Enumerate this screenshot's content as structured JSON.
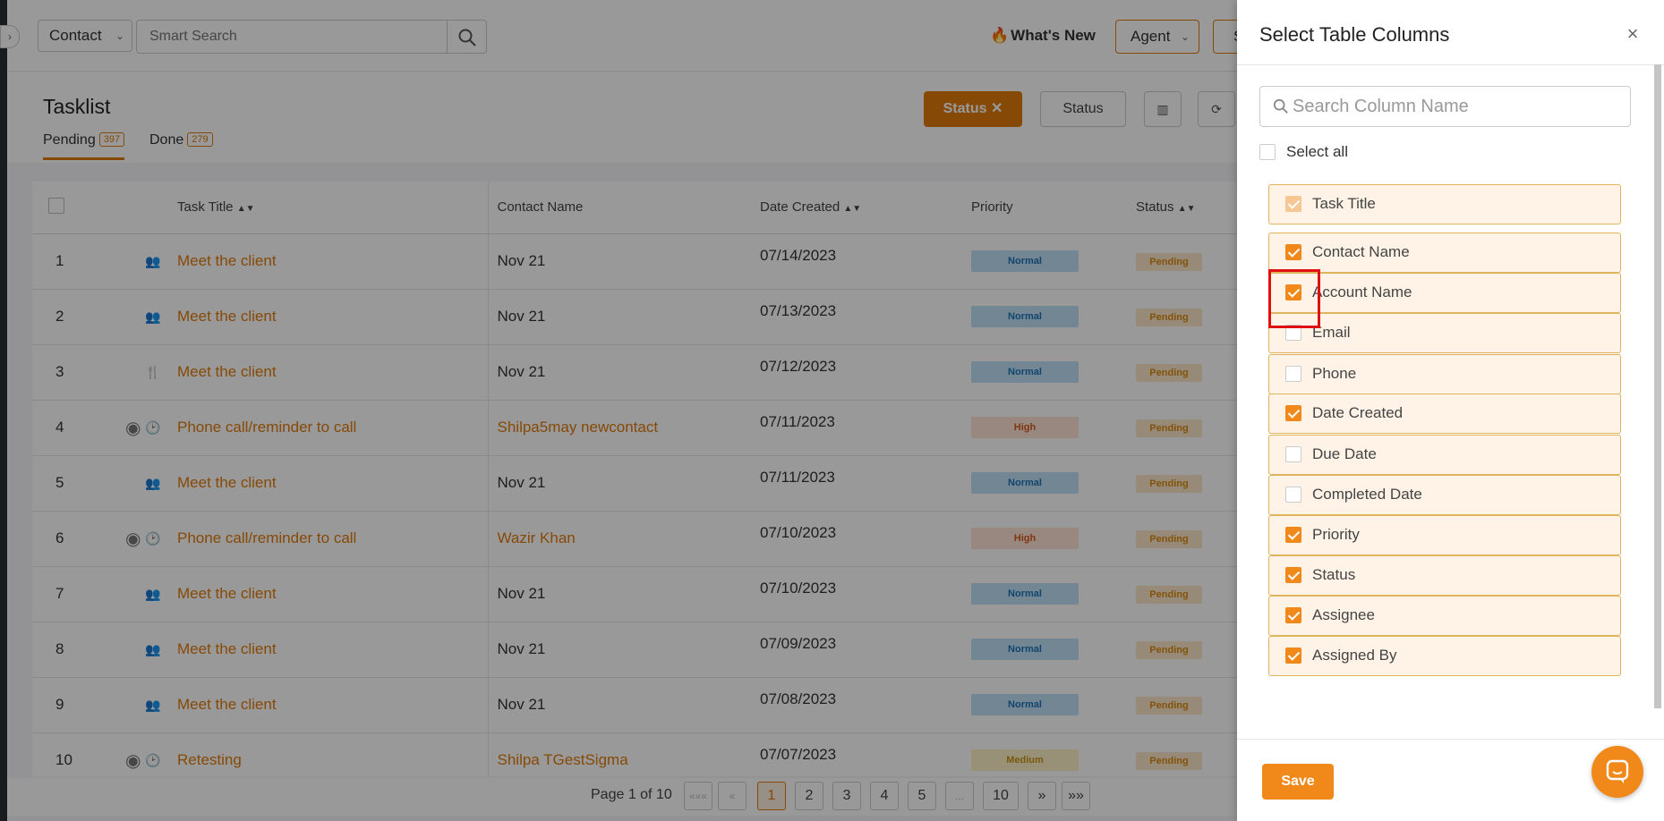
{
  "topbar": {
    "entity_select": "Contact",
    "search_placeholder": "Smart Search",
    "whats_new": "What's New",
    "agent_select": "Agent",
    "cut_button": "S"
  },
  "header": {
    "title": "Tasklist",
    "tabs": [
      {
        "label": "Pending",
        "count": "397"
      },
      {
        "label": "Done",
        "count": "279"
      }
    ],
    "status_filter_chip": "Status ✕",
    "status_button": "Status"
  },
  "table": {
    "columns": [
      "Task Title",
      "Contact Name",
      "Date Created",
      "Priority",
      "Status"
    ],
    "rows": [
      {
        "num": "1",
        "title": "Meet the client",
        "contact": "Nov 21",
        "date": "07/14/2023",
        "priority": "Normal",
        "status": "Pending"
      },
      {
        "num": "2",
        "title": "Meet the client",
        "contact": "Nov 21",
        "date": "07/13/2023",
        "priority": "Normal",
        "status": "Pending"
      },
      {
        "num": "3",
        "title": "Meet the client",
        "contact": "Nov 21",
        "date": "07/12/2023",
        "priority": "Normal",
        "status": "Pending"
      },
      {
        "num": "4",
        "title": "Phone call/reminder to call",
        "contact": "Shilpa5may newcontact",
        "date": "07/11/2023",
        "priority": "High",
        "status": "Pending"
      },
      {
        "num": "5",
        "title": "Meet the client",
        "contact": "Nov 21",
        "date": "07/11/2023",
        "priority": "Normal",
        "status": "Pending"
      },
      {
        "num": "6",
        "title": "Phone call/reminder to call",
        "contact": "Wazir Khan",
        "date": "07/10/2023",
        "priority": "High",
        "status": "Pending"
      },
      {
        "num": "7",
        "title": "Meet the client",
        "contact": "Nov 21",
        "date": "07/10/2023",
        "priority": "Normal",
        "status": "Pending"
      },
      {
        "num": "8",
        "title": "Meet the client",
        "contact": "Nov 21",
        "date": "07/09/2023",
        "priority": "Normal",
        "status": "Pending"
      },
      {
        "num": "9",
        "title": "Meet the client",
        "contact": "Nov 21",
        "date": "07/08/2023",
        "priority": "Normal",
        "status": "Pending"
      },
      {
        "num": "10",
        "title": "Retesting",
        "contact": "Shilpa TGestSigma",
        "date": "07/07/2023",
        "priority": "Medium",
        "status": "Pending"
      }
    ]
  },
  "pagination": {
    "info": "Page 1 of 10",
    "first": "«««",
    "prev": "«",
    "pages": [
      "1",
      "2",
      "3",
      "4",
      "5",
      "...",
      "10"
    ],
    "next": "»",
    "last": "»»"
  },
  "drawer": {
    "title": "Select Table Columns",
    "close": "×",
    "search_placeholder": "Search Column Name",
    "select_all": "Select all",
    "columns": [
      {
        "label": "Task Title",
        "checked": true,
        "disabled": true
      },
      {
        "label": "Contact Name",
        "checked": true
      },
      {
        "label": "Account Name",
        "checked": true
      },
      {
        "label": "Email",
        "checked": false
      },
      {
        "label": "Phone",
        "checked": false
      },
      {
        "label": "Date Created",
        "checked": true
      },
      {
        "label": "Due Date",
        "checked": false
      },
      {
        "label": "Completed Date",
        "checked": false
      },
      {
        "label": "Priority",
        "checked": true
      },
      {
        "label": "Status",
        "checked": true
      },
      {
        "label": "Assignee",
        "checked": true
      },
      {
        "label": "Assigned By",
        "checked": true
      }
    ],
    "save": "Save"
  },
  "colors": {
    "accent": "#e07b0b",
    "checkbox": "#f0891a",
    "highlight": "#e01010"
  }
}
